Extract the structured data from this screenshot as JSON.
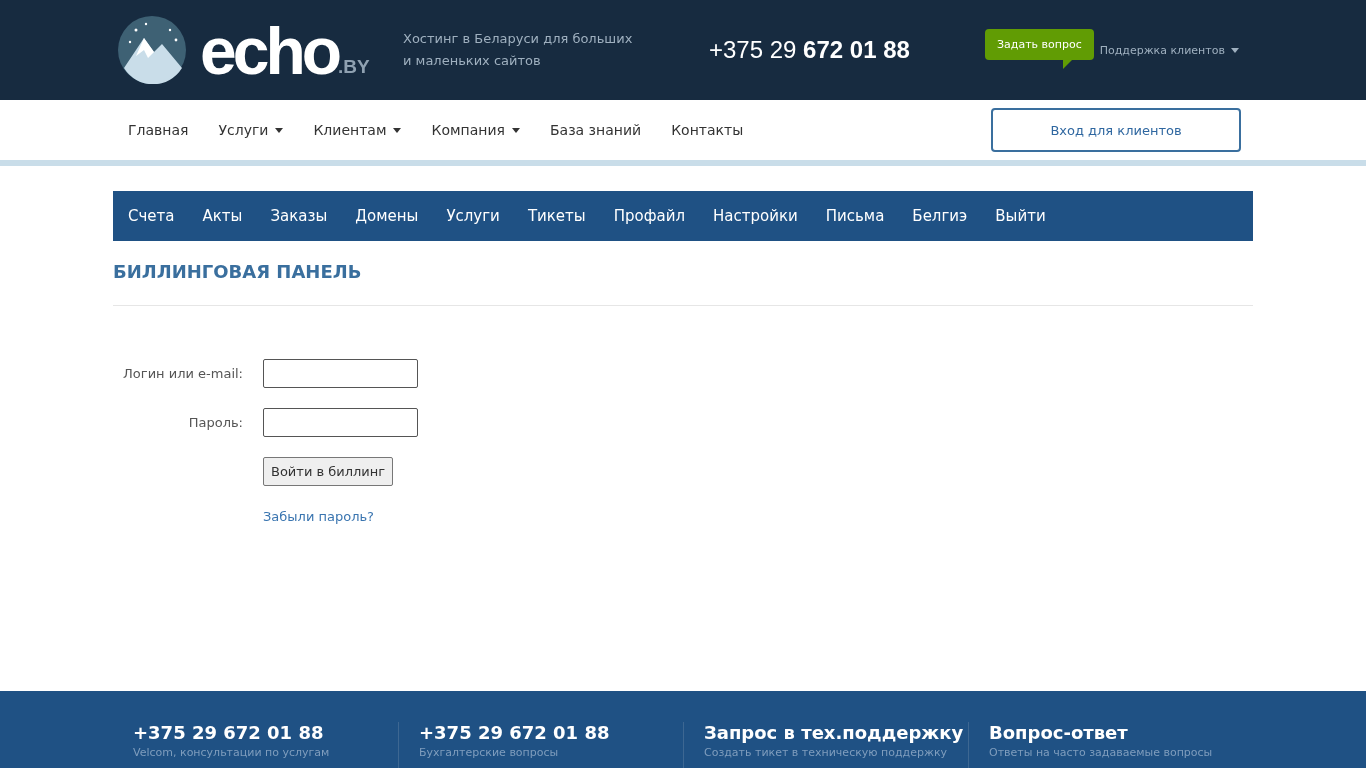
{
  "header": {
    "logo": {
      "word": "echo",
      "suffix": ".BY"
    },
    "tagline": "Хостинг в Беларуси для больших и маленьких сайтов",
    "phone": "+375 29 **672 01 88**",
    "ask_button": "Задать вопрос",
    "support_menu": "Поддержка клиентов"
  },
  "nav": {
    "items": [
      {
        "label": "Главная",
        "dropdown": false
      },
      {
        "label": "Услуги",
        "dropdown": true
      },
      {
        "label": "Клиентам",
        "dropdown": true
      },
      {
        "label": "Компания",
        "dropdown": true
      },
      {
        "label": "База знаний",
        "dropdown": false
      },
      {
        "label": "Контакты",
        "dropdown": false
      }
    ],
    "login_button": "Вход для клиентов"
  },
  "billing_menu": [
    "Счета",
    "Акты",
    "Заказы",
    "Домены",
    "Услуги",
    "Тикеты",
    "Профайл",
    "Настройки",
    "Письма",
    "Белгиэ",
    "Выйти"
  ],
  "page_title": "БИЛЛИНГОВАЯ ПАНЕЛЬ",
  "form": {
    "fields": [
      {
        "label": "Логин или e-mail:"
      },
      {
        "label": "Пароль:"
      }
    ],
    "submit": "Войти в биллинг",
    "forgot_link": "Забыли пароль?"
  },
  "footer": [
    {
      "title": "+375 29 672 01 88",
      "subtitle": "Velcom, консультации по услугам"
    },
    {
      "title": "+375 29 672 01 88",
      "subtitle": "Бухгалтерские вопросы"
    },
    {
      "title": "Запрос в тех.поддержку",
      "subtitle": "Создать тикет в техническую поддержку"
    },
    {
      "title": "Вопрос-ответ",
      "subtitle": "Ответы на часто задаваемые вопросы"
    }
  ]
}
